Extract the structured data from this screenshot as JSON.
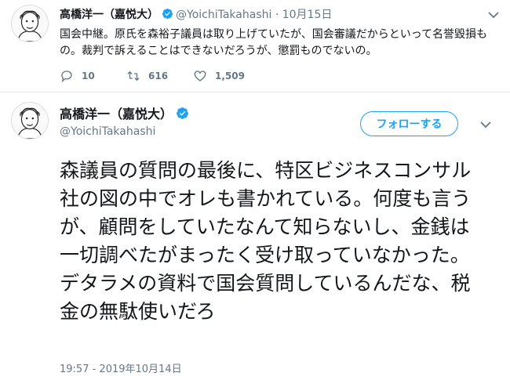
{
  "top_tweet": {
    "author_name": "高橋洋一（嘉悦大）",
    "handle": "@YoichiTakahashi",
    "separator": "·",
    "date": "10月15日",
    "text": "国会中継。原氏を森裕子議員は取り上げていたが、国会審議だからといって名誉毀損もの。裁判で訴えることはできないだろうが、懲罰ものでないの。",
    "reply_count": "10",
    "retweet_count": "616",
    "like_count": "1,509"
  },
  "main_tweet": {
    "author_name": "高橋洋一（嘉悦大）",
    "handle": "@YoichiTakahashi",
    "follow_label": "フォローする",
    "text": "森議員の質問の最後に、特区ビジネスコンサル社の図の中でオレも書かれている。何度も言うが、顧問をしていたなんて知らないし、金銭は一切調べたがまったく受け取っていなかった。デタラメの資料で国会質問しているんだな、税金の無駄使いだろ",
    "timestamp": "19:57 - 2019年10月14日"
  },
  "colors": {
    "accent": "#1da1f2",
    "secondary_text": "#657786",
    "primary_text": "#14171a",
    "divider": "#e6ecf0"
  },
  "icons": {
    "verified": "verified-badge-icon",
    "reply": "reply-icon",
    "retweet": "retweet-icon",
    "like": "heart-icon",
    "more": "chevron-down-icon"
  }
}
